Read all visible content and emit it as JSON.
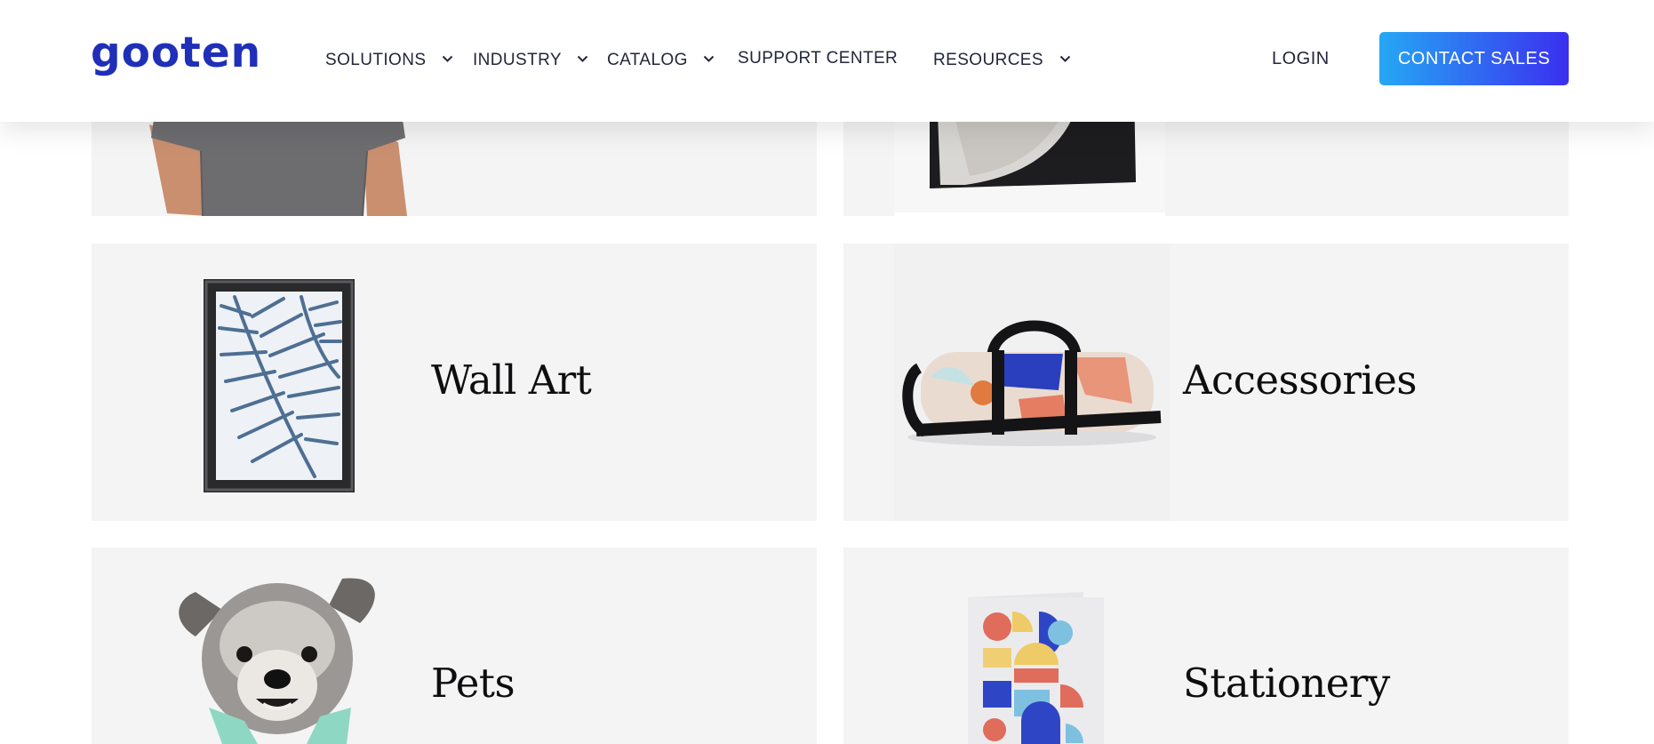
{
  "header": {
    "logo_text": "gooten",
    "nav": [
      {
        "label": "SOLUTIONS",
        "has_dropdown": true
      },
      {
        "label": "INDUSTRY",
        "has_dropdown": true
      },
      {
        "label": "CATALOG",
        "has_dropdown": true
      },
      {
        "label": "SUPPORT CENTER",
        "has_dropdown": false
      },
      {
        "label": "RESOURCES",
        "has_dropdown": true
      }
    ],
    "login_label": "LOGIN",
    "contact_label": "CONTACT SALES"
  },
  "categories": [
    {
      "title": "",
      "icon": "tshirt-image"
    },
    {
      "title": "",
      "icon": "blanket-image"
    },
    {
      "title": "Wall Art",
      "icon": "framed-print-image"
    },
    {
      "title": "Accessories",
      "icon": "duffel-bag-image"
    },
    {
      "title": "Pets",
      "icon": "dog-image"
    },
    {
      "title": "Stationery",
      "icon": "greeting-card-image"
    }
  ],
  "colors": {
    "brand": "#1f2fb8",
    "cta_gradient_start": "#25a8f4",
    "cta_gradient_end": "#3b2ff0",
    "card_bg": "#f4f4f5",
    "text_dark": "#23263a"
  }
}
